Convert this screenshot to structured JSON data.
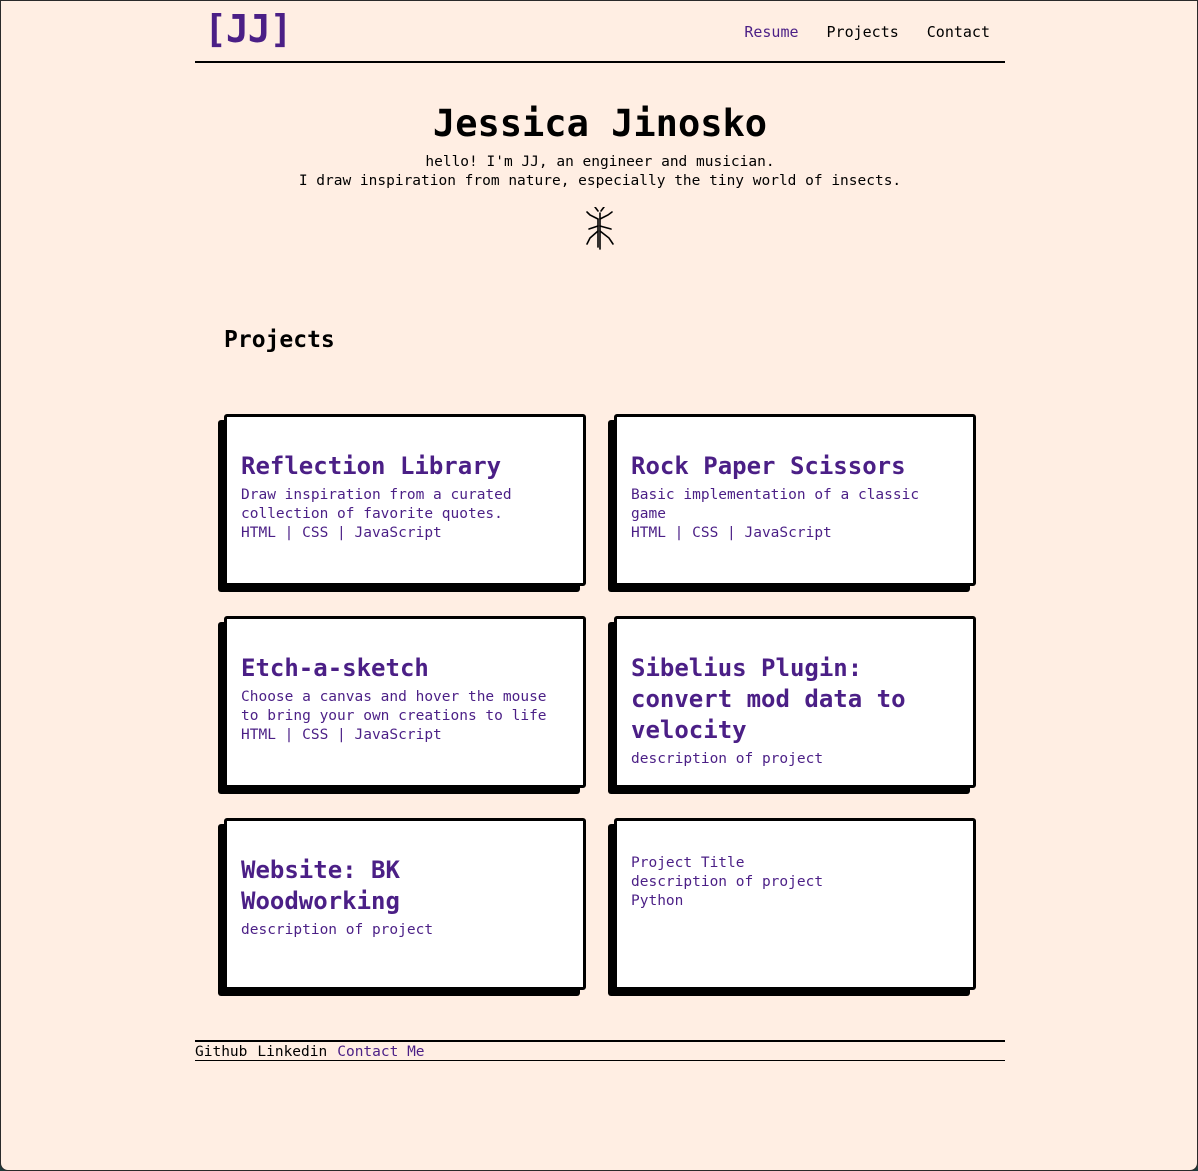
{
  "header": {
    "logo": "[JJ]",
    "nav": [
      "Resume",
      "Projects",
      "Contact"
    ]
  },
  "hero": {
    "name": "Jessica Jinosko",
    "line1": "hello! I'm JJ, an engineer and musician.",
    "line2": "I draw inspiration from nature, especially the tiny world of insects."
  },
  "projects": {
    "heading": "Projects",
    "cards": [
      {
        "title": "Reflection Library",
        "desc": "Draw inspiration from a curated collection of favorite quotes.",
        "tech": "HTML | CSS | JavaScript"
      },
      {
        "title": "Rock Paper Scissors",
        "desc": "Basic implementation of a classic game",
        "tech": "HTML | CSS | JavaScript"
      },
      {
        "title": "Etch-a-sketch",
        "desc": "Choose a canvas and hover the mouse to bring your own creations to life",
        "tech": "HTML | CSS | JavaScript"
      },
      {
        "title": "Sibelius Plugin: convert mod data to velocity",
        "desc": "description of project"
      },
      {
        "title": "Website: BK Woodworking",
        "desc": "description of project"
      },
      {
        "title": "Project Title",
        "desc": "description of project",
        "tech": "Python"
      }
    ]
  },
  "footer": {
    "github": "Github",
    "linkedin": "Linkedin",
    "contact": "Contact Me"
  },
  "colors": {
    "background": "#ffeee3",
    "accent": "#4b1f86",
    "card": "#ffffff"
  },
  "icons": {
    "hero_icon": "stick-insect-icon"
  }
}
